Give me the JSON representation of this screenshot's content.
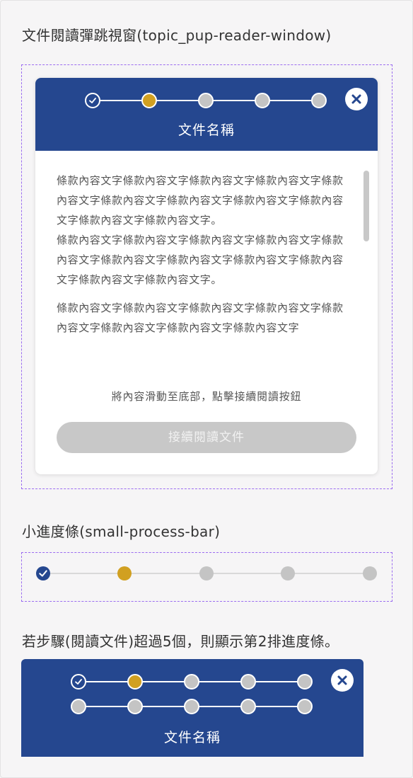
{
  "section1": {
    "title": "文件閱讀彈跳視窗(topic_pup-reader-window)"
  },
  "modal": {
    "title": "文件名稱",
    "paragraphs": [
      "條款內容文字條款內容文字條款內容文字條款內容文字條款內容文字條款內容文字條款內容文字條款內容文字條款內容文字條款內容文字條款內容文字。",
      "條款內容文字條款內容文字條款內容文字條款內容文字條款內容文字條款內容文字條款內容文字條款內容文字條款內容文字條款內容文字條款內容文字。",
      "條款內容文字條款內容文字條款內容文字條款內容文字條款內容文字條款內容文字條款內容文字條款內容文字"
    ],
    "hint": "將內容滑動至底部，點擊接續閱讀按鈕",
    "continue_button": "接續閱讀文件",
    "steps": [
      "done",
      "active",
      "todo",
      "todo",
      "todo"
    ]
  },
  "section2": {
    "title": "小進度條(small-process-bar)",
    "steps": [
      "done",
      "active",
      "todo",
      "todo",
      "todo",
      "todo"
    ]
  },
  "section3": {
    "title": "若步驟(閱讀文件)超過5個，則顯示第2排進度條。",
    "header_title": "文件名稱",
    "row1_steps": [
      "done",
      "active",
      "todo",
      "todo",
      "todo"
    ],
    "row2_steps": [
      "todo",
      "todo",
      "todo",
      "todo",
      "todo"
    ]
  },
  "colors": {
    "primary": "#25478f",
    "active": "#d1a021",
    "inactive": "#c4c4c4",
    "dashed_border": "#9b6cf0"
  },
  "icons": {
    "done": "check-icon",
    "close": "close-icon"
  }
}
